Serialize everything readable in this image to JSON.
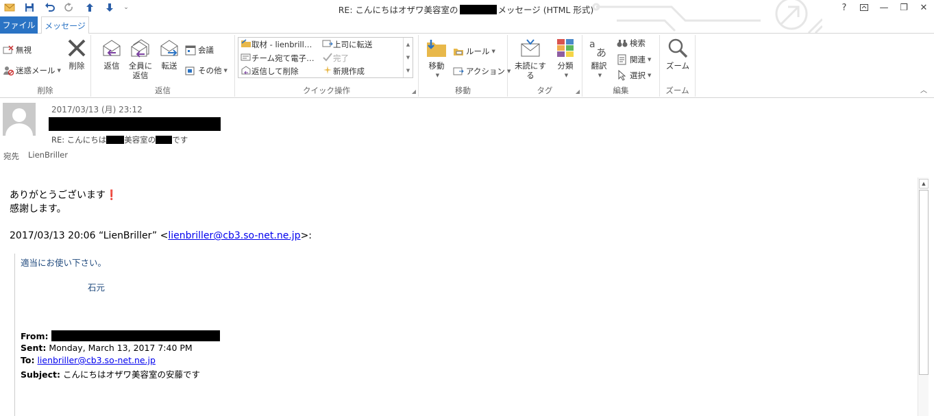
{
  "window": {
    "title_prefix": "RE: こんにちはオザワ美容室の",
    "title_suffix": "メッセージ (HTML 形式)",
    "help": "?",
    "minimize": "—",
    "restore": "❐",
    "close": "✕"
  },
  "tabs": {
    "file": "ファイル",
    "message": "メッセージ"
  },
  "ribbon": {
    "delete_group": {
      "label": "削除",
      "ignore": "無視",
      "junk": "迷惑メール",
      "delete": "削除"
    },
    "respond_group": {
      "label": "返信",
      "reply": "返信",
      "reply_all_line1": "全員に",
      "reply_all_line2": "返信",
      "forward": "転送",
      "meeting": "会議",
      "more": "その他"
    },
    "quick_steps_group": {
      "label": "クイック操作",
      "items": [
        "取材 - lienbrill…",
        "上司に転送",
        "チーム宛て電子…",
        "完了",
        "返信して削除",
        "新規作成"
      ]
    },
    "move_group": {
      "label": "移動",
      "move": "移動",
      "rules": "ルール",
      "actions": "アクション"
    },
    "tags_group": {
      "label": "タグ",
      "unread": "未読にする",
      "categorize": "分類"
    },
    "edit_group": {
      "label": "編集",
      "translate": "翻訳",
      "search": "検索",
      "related": "関連",
      "select": "選択"
    },
    "zoom_group": {
      "label": "ズーム",
      "zoom": "ズーム"
    }
  },
  "header": {
    "date": "2017/03/13 (月) 23:12",
    "subject_prefix": "RE: こんにちは",
    "subject_mid": "美容室の",
    "subject_suffix": "です",
    "to_label": "宛先",
    "to_value": "LienBriller"
  },
  "body": {
    "line1": "ありがとうございます❗",
    "line2": "感謝します。",
    "quote_header_prefix": "2017/03/13 20:06 “LienBriller” <",
    "quote_header_email": "lienbriller@cb3.so-net.ne.jp",
    "quote_header_suffix": ">:",
    "quote_line1": "適当にお使い下さい。",
    "quote_signature": "石元",
    "from_label": "From:",
    "sent_label": "Sent:",
    "sent_value": "Monday, March 13, 2017 7:40 PM",
    "to_label": "To:",
    "to_email": "lienbriller@cb3.so-net.ne.jp",
    "subject_label": "Subject:",
    "subject_value": "こんにちはオザワ美容室の安藤です"
  },
  "colors": {
    "file_tab": "#2a73c4",
    "link": "#0000ee",
    "quote_text": "#1f497d"
  }
}
